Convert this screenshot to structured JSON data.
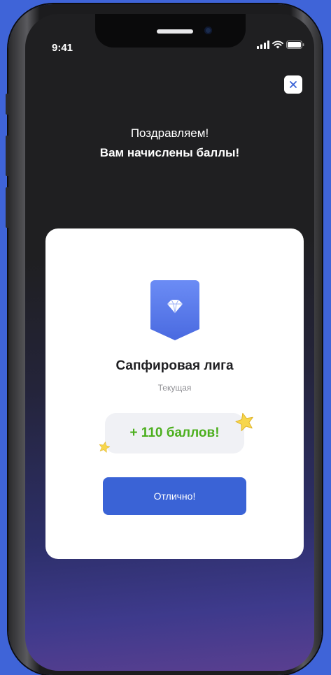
{
  "status_bar": {
    "time": "9:41",
    "icons": [
      "signal-icon",
      "wifi-icon",
      "battery-icon"
    ]
  },
  "modal": {
    "close_icon": "close-icon",
    "heading_line1": "Поздравляем!",
    "heading_line2": "Вам начислены баллы!"
  },
  "card": {
    "badge_icon": "diamond-icon",
    "league_title": "Сапфировая лига",
    "league_status": "Текущая",
    "points_label": "+ 110 баллов!",
    "confirm_button": "Отлично!"
  },
  "colors": {
    "page_background": "#3f64d8",
    "screen_background": "#1f1f21",
    "accent_blue": "#3a63d6",
    "points_green": "#4caf1e",
    "badge_blue": "#5b7ff0",
    "star_yellow": "#f5d54a"
  }
}
